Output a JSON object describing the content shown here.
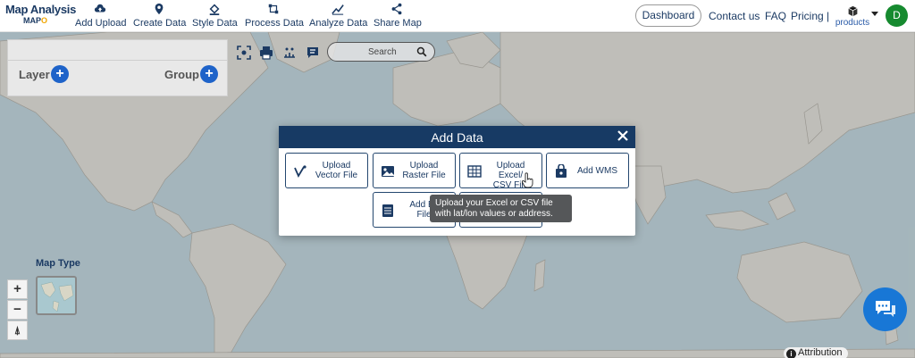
{
  "brand": {
    "title": "Map Analysis",
    "sub_prefix": "MAP",
    "sub_suffix": "O"
  },
  "nav": [
    {
      "label": "Add Upload",
      "icon": "cloud-upload-icon"
    },
    {
      "label": "Create Data",
      "icon": "map-pin-icon"
    },
    {
      "label": "Style Data",
      "icon": "paint-bucket-icon"
    },
    {
      "label": "Process Data",
      "icon": "process-icon"
    },
    {
      "label": "Analyze Data",
      "icon": "analyze-icon"
    },
    {
      "label": "Share Map",
      "icon": "share-icon"
    }
  ],
  "header": {
    "dashboard": "Dashboard",
    "contact": "Contact us",
    "faq": "FAQ",
    "pricing": "Pricing |",
    "products": "products",
    "avatar": "D"
  },
  "panel": {
    "layer": "Layer",
    "group": "Group",
    "plus": "+"
  },
  "toolbar": {
    "search_placeholder": "Search"
  },
  "map_type": {
    "label": "Map Type"
  },
  "zoom": {
    "in": "+",
    "out": "−",
    "reset": "⍋"
  },
  "attribution": "Attribution",
  "modal": {
    "title": "Add Data",
    "options": [
      {
        "line1": "Upload",
        "line2": "Vector File",
        "icon": "vector-icon"
      },
      {
        "line1": "Upload",
        "line2": "Raster File",
        "icon": "raster-image-icon"
      },
      {
        "line1": "Upload Excel/",
        "line2": "CSV File",
        "icon": "spreadsheet-icon"
      },
      {
        "line1": "Add WMS",
        "line2": "",
        "icon": "wms-icon"
      },
      {
        "line1": "Add Ex",
        "line2": "File",
        "icon": "table-file-icon"
      }
    ],
    "tooltip_line1": "Upload your Excel or CSV file",
    "tooltip_line2": "with lat/lon values or address."
  },
  "colors": {
    "navy": "#173a64",
    "accent_blue": "#1e63c9",
    "avatar_green": "#168a2f",
    "chat_blue": "#1877d6"
  }
}
